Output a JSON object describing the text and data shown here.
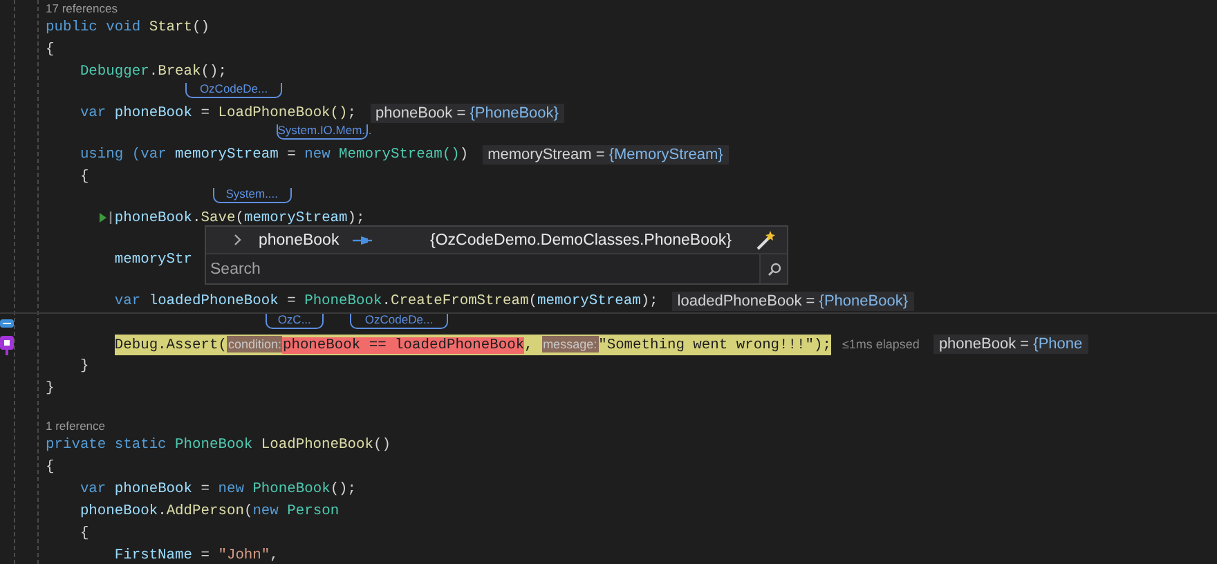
{
  "editor": {
    "lines": [
      {
        "kind": "codelens",
        "text": "17 references"
      },
      {
        "kind": "code",
        "tokens": [
          {
            "t": "public void ",
            "kind": "kw"
          },
          {
            "t": "Start",
            "kind": "method"
          },
          {
            "t": "()",
            "kind": "plain"
          }
        ]
      },
      {
        "kind": "code",
        "tokens": [
          {
            "t": "{",
            "kind": "plain"
          }
        ]
      },
      {
        "kind": "code",
        "tokens": [
          {
            "t": "    Debugger",
            "kind": "type"
          },
          {
            "t": ".",
            "kind": "plain"
          },
          {
            "t": "Break",
            "kind": "method"
          },
          {
            "t": "();",
            "kind": "plain"
          }
        ]
      },
      {
        "kind": "code",
        "tokens": [
          {
            "t": "    var ",
            "kind": "kw"
          },
          {
            "t": "phoneBook",
            "kind": "var"
          },
          {
            "t": " = ",
            "kind": "plain"
          },
          {
            "t": "LoadPhoneBook()",
            "kind": "method",
            "hint": "OzCodeDe..."
          },
          {
            "t": ";",
            "kind": "plain"
          }
        ],
        "datatip": {
          "name": "phoneBook",
          "operator": "=",
          "value": "{PhoneBook}"
        }
      },
      {
        "kind": "code",
        "tokens": [
          {
            "t": "    using (",
            "kind": "kw"
          },
          {
            "t": "var ",
            "kind": "kw"
          },
          {
            "t": "memoryStream",
            "kind": "var"
          },
          {
            "t": " = ",
            "kind": "plain"
          },
          {
            "t": "new ",
            "kind": "kw"
          },
          {
            "t": "MemoryStream()",
            "kind": "type",
            "hint": "System.IO.Mem..."
          },
          {
            "t": ")",
            "kind": "plain"
          }
        ],
        "datatip": {
          "name": "memoryStream",
          "operator": "=",
          "value": "{MemoryStream}"
        }
      },
      {
        "kind": "code",
        "tokens": [
          {
            "t": "    {",
            "kind": "plain"
          }
        ]
      },
      {
        "kind": "code",
        "run_here": true,
        "tokens": [
          {
            "t": "        phoneBook",
            "kind": "var"
          },
          {
            "t": ".",
            "kind": "plain"
          },
          {
            "t": "Save",
            "kind": "method"
          },
          {
            "t": "(",
            "kind": "plain"
          },
          {
            "t": "memoryStream",
            "kind": "var",
            "hint": "System...."
          },
          {
            "t": ");",
            "kind": "plain"
          }
        ]
      },
      {
        "kind": "code",
        "annotated": true,
        "tokens": [
          {
            "t": "        memoryStr",
            "kind": "var"
          }
        ]
      },
      {
        "kind": "code",
        "annotated": true,
        "tokens": [
          {
            "t": "        var ",
            "kind": "kw"
          },
          {
            "t": "loadedPhoneBook",
            "kind": "var"
          },
          {
            "t": " = ",
            "kind": "plain"
          },
          {
            "t": "PhoneBook",
            "kind": "type"
          },
          {
            "t": ".",
            "kind": "plain"
          },
          {
            "t": "CreateFromStream",
            "kind": "method"
          },
          {
            "t": "(",
            "kind": "plain"
          },
          {
            "t": "memoryStream",
            "kind": "var"
          },
          {
            "t": ");",
            "kind": "plain"
          }
        ],
        "datatip": {
          "name": "loadedPhoneBook",
          "operator": "=",
          "value": "{PhoneBook}"
        }
      },
      {
        "kind": "code",
        "current": true,
        "tokens": [
          {
            "t": "        Debug.Assert(",
            "kind": "plain"
          },
          {
            "t": "condition:",
            "kind": "param"
          },
          {
            "t": "phoneBook",
            "kind": "failed",
            "hint": "OzC..."
          },
          {
            "t": " == ",
            "kind": "failed"
          },
          {
            "t": "loadedPhoneBook",
            "kind": "failed",
            "hint": "OzCodeDe..."
          },
          {
            "t": ", ",
            "kind": "plain"
          },
          {
            "t": "message:",
            "kind": "param"
          },
          {
            "t": "\"Something went wrong!!!\"",
            "kind": "string"
          },
          {
            "t": ");",
            "kind": "plain"
          }
        ],
        "elapsed": "≤1ms elapsed",
        "datatip": {
          "name": "phoneBook",
          "operator": "=",
          "value": "{Phone"
        }
      },
      {
        "kind": "code",
        "tokens": [
          {
            "t": "    }",
            "kind": "plain"
          }
        ]
      },
      {
        "kind": "code",
        "tokens": [
          {
            "t": "}",
            "kind": "plain"
          }
        ]
      },
      {
        "kind": "blank"
      },
      {
        "kind": "codelens",
        "text": "1 reference"
      },
      {
        "kind": "code",
        "tokens": [
          {
            "t": "private static ",
            "kind": "kw"
          },
          {
            "t": "PhoneBook ",
            "kind": "type"
          },
          {
            "t": "LoadPhoneBook",
            "kind": "method"
          },
          {
            "t": "()",
            "kind": "plain"
          }
        ]
      },
      {
        "kind": "code",
        "tokens": [
          {
            "t": "{",
            "kind": "plain"
          }
        ]
      },
      {
        "kind": "code",
        "tokens": [
          {
            "t": "    var ",
            "kind": "kw"
          },
          {
            "t": "phoneBook",
            "kind": "var"
          },
          {
            "t": " = ",
            "kind": "plain"
          },
          {
            "t": "new ",
            "kind": "kw"
          },
          {
            "t": "PhoneBook",
            "kind": "type"
          },
          {
            "t": "();",
            "kind": "plain"
          }
        ]
      },
      {
        "kind": "code",
        "tokens": [
          {
            "t": "    phoneBook",
            "kind": "var"
          },
          {
            "t": ".",
            "kind": "plain"
          },
          {
            "t": "AddPerson",
            "kind": "method"
          },
          {
            "t": "(",
            "kind": "plain"
          },
          {
            "t": "new ",
            "kind": "kw"
          },
          {
            "t": "Person",
            "kind": "type"
          }
        ]
      },
      {
        "kind": "code",
        "tokens": [
          {
            "t": "    {",
            "kind": "plain"
          }
        ]
      },
      {
        "kind": "code",
        "tokens": [
          {
            "t": "        FirstName",
            "kind": "var"
          },
          {
            "t": " = ",
            "kind": "plain"
          },
          {
            "t": "\"John\"",
            "kind": "string"
          },
          {
            "t": ",",
            "kind": "plain"
          }
        ]
      }
    ]
  },
  "datatip_popup": {
    "name": "phoneBook",
    "value": "{OzCodeDemo.DemoClasses.PhoneBook}",
    "expanded": false,
    "search": {
      "placeholder": "Search"
    }
  }
}
